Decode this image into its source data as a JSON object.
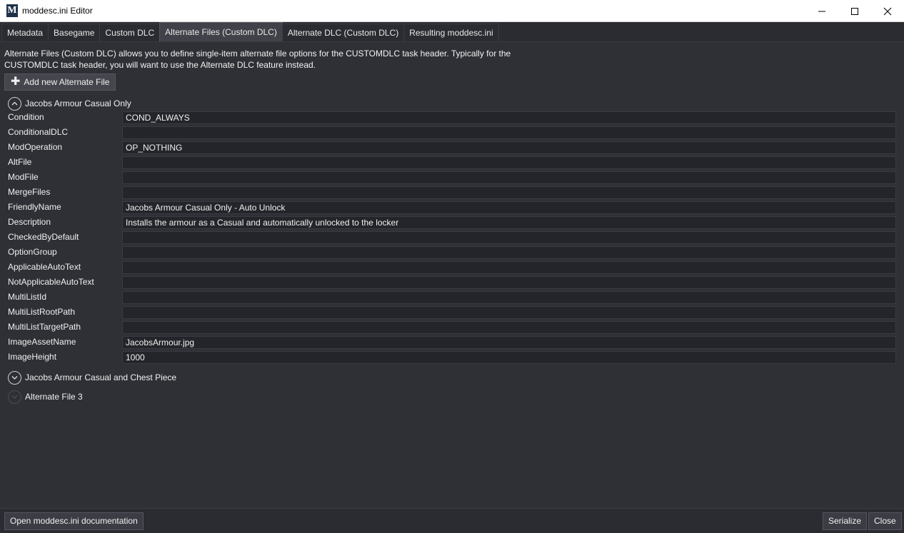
{
  "window": {
    "title": "moddesc.ini Editor",
    "icon_letter": "M",
    "controls": [
      "minimize-icon",
      "maximize-icon",
      "close-icon"
    ]
  },
  "tabs": [
    {
      "label": "Metadata",
      "active": false
    },
    {
      "label": "Basegame",
      "active": false
    },
    {
      "label": "Custom DLC",
      "active": false
    },
    {
      "label": "Alternate Files (Custom DLC)",
      "active": true
    },
    {
      "label": "Alternate DLC (Custom DLC)",
      "active": false
    },
    {
      "label": "Resulting moddesc.ini",
      "active": false
    }
  ],
  "description": "Alternate Files (Custom DLC) allows you to define single-item alternate file options for the CUSTOMDLC task header. Typically for the CUSTOMDLC task header, you will want to use the Alternate DLC feature instead.",
  "add_button": {
    "label": "Add new Alternate File",
    "icon": "plus-icon"
  },
  "expanders": [
    {
      "title": "Jacobs Armour Casual Only",
      "expanded": true,
      "icon": "chevron-up-icon"
    },
    {
      "title": "Jacobs Armour Casual and Chest Piece",
      "expanded": false,
      "icon": "chevron-down-icon"
    },
    {
      "title": "Alternate File 3",
      "expanded": false,
      "icon": "chevron-down-icon"
    }
  ],
  "fields": [
    {
      "label": "Condition",
      "value": "COND_ALWAYS"
    },
    {
      "label": "ConditionalDLC",
      "value": ""
    },
    {
      "label": "ModOperation",
      "value": "OP_NOTHING"
    },
    {
      "label": "AltFile",
      "value": ""
    },
    {
      "label": "ModFile",
      "value": ""
    },
    {
      "label": "MergeFiles",
      "value": ""
    },
    {
      "label": "FriendlyName",
      "value": "Jacobs Armour Casual Only - Auto Unlock"
    },
    {
      "label": "Description",
      "value": "Installs the armour as a Casual and automatically unlocked to the locker"
    },
    {
      "label": "CheckedByDefault",
      "value": ""
    },
    {
      "label": "OptionGroup",
      "value": ""
    },
    {
      "label": "ApplicableAutoText",
      "value": ""
    },
    {
      "label": "NotApplicableAutoText",
      "value": ""
    },
    {
      "label": "MultiListId",
      "value": ""
    },
    {
      "label": "MultiListRootPath",
      "value": ""
    },
    {
      "label": "MultiListTargetPath",
      "value": ""
    },
    {
      "label": "ImageAssetName",
      "value": "JacobsArmour.jpg"
    },
    {
      "label": "ImageHeight",
      "value": "1000"
    }
  ],
  "bottom": {
    "docs_label": "Open moddesc.ini documentation",
    "serialize_label": "Serialize",
    "close_label": "Close"
  }
}
